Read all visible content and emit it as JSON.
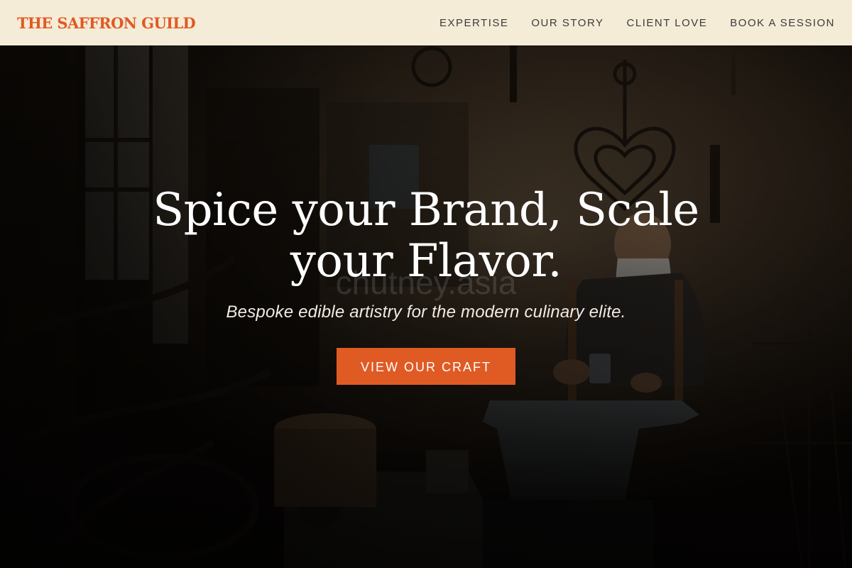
{
  "navbar": {
    "brand": "THE SAFFRON GUILD",
    "links": [
      {
        "label": "EXPERTISE"
      },
      {
        "label": "OUR STORY"
      },
      {
        "label": "CLIENT LOVE"
      },
      {
        "label": "BOOK A SESSION"
      }
    ]
  },
  "hero": {
    "title": "Spice your Brand, Scale your Flavor.",
    "subtitle": "Bespoke edible artistry for the modern culinary elite.",
    "cta_label": "VIEW OUR CRAFT",
    "watermark": "chutney.asia"
  },
  "colors": {
    "accent": "#e05a24",
    "nav_background": "#f5ecd7",
    "nav_text": "#3b3b3b"
  }
}
